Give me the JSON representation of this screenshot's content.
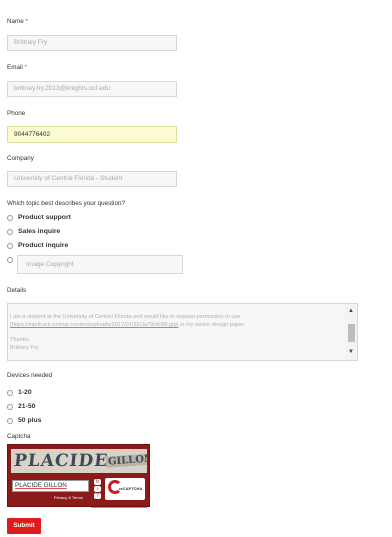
{
  "form": {
    "name": {
      "label": "Name",
      "required_mark": "*",
      "value": "Brittney Fry"
    },
    "email": {
      "label": "Email",
      "required_mark": "*",
      "value": "brittney.fry.2013@knights.ucf.edu"
    },
    "phone": {
      "label": "Phone",
      "value": "9044776402"
    },
    "company": {
      "label": "Company",
      "value": "University of Central Florida - Student"
    },
    "topic": {
      "label": "Which topic best describes your question?",
      "options": [
        "Product support",
        "Sales inquire",
        "Product inquire"
      ],
      "other_value": "Image Copyright"
    },
    "details": {
      "label": "Details",
      "line1": "I am a student at the University of Central Florida and would like to request permission to use",
      "line2_link": "(https://intellrack.net/wp-content/uploads/2017/01/31/Ja79nK98l.jpg)",
      "line2_rest": " in my senior design paper.",
      "line3": "Thanks,",
      "line4": "Brittney Fry"
    },
    "devices": {
      "label": "Devices needed",
      "options": [
        "1-20",
        "21-50",
        "50 plus"
      ]
    },
    "captcha": {
      "label": "Captcha",
      "word1": "PLACIDE",
      "word2": "GILLON",
      "input_value": "PLACIDE GILLON",
      "privacy_text": "Privacy & Terms",
      "logo_text": "reCAPTCHA"
    },
    "submit_label": "Submit"
  },
  "colors": {
    "accent": "#e01b1b",
    "autofill": "#fafbd0",
    "captcha_bg": "#8b1a1a"
  },
  "icons": [
    "scroll-up-arrow",
    "scroll-down-arrow",
    "refresh-icon",
    "audio-icon",
    "help-icon"
  ]
}
